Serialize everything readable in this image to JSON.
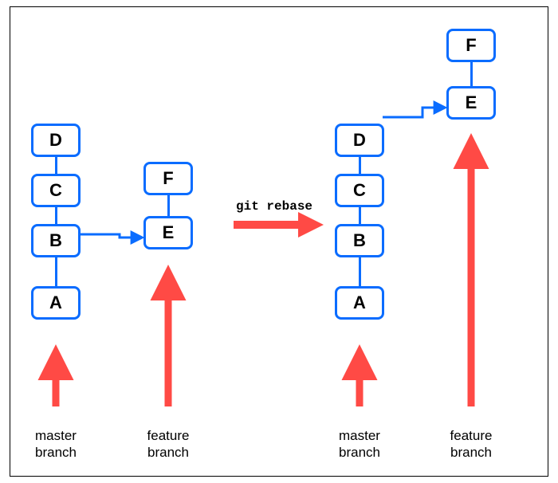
{
  "diagram": {
    "left_master": {
      "c0": "D",
      "c1": "C",
      "c2": "B",
      "c3": "A"
    },
    "left_feature": {
      "c0": "F",
      "c1": "E"
    },
    "right_master": {
      "c0": "D",
      "c1": "C",
      "c2": "B",
      "c3": "A"
    },
    "right_feature": {
      "c0": "F",
      "c1": "E"
    },
    "operation": "git rebase",
    "labels": {
      "master_l": "master\nbranch",
      "feature_l": "feature\nbranch",
      "master_r": "master\nbranch",
      "feature_r": "feature\nbranch"
    }
  },
  "chart_data": {
    "type": "diagram",
    "title": "git rebase",
    "before": {
      "master": [
        "A",
        "B",
        "C",
        "D"
      ],
      "feature": [
        "E",
        "F"
      ],
      "feature_base": "B"
    },
    "after": {
      "master": [
        "A",
        "B",
        "C",
        "D"
      ],
      "feature": [
        "E",
        "F"
      ],
      "feature_base": "D"
    }
  }
}
